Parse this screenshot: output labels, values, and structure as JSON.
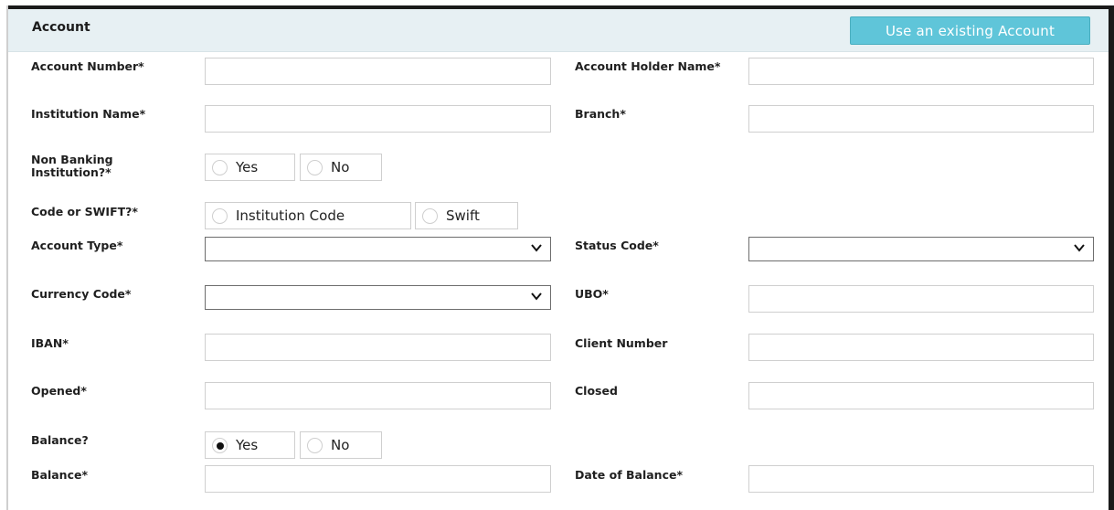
{
  "section": {
    "title": "Account",
    "use_existing_button": "Use an existing Account"
  },
  "labels": {
    "account_number": "Account Number*",
    "account_holder_name": "Account Holder Name*",
    "institution_name": "Institution Name*",
    "branch": "Branch*",
    "non_banking": "Non Banking Institution?*",
    "code_or_swift": "Code or SWIFT?*",
    "account_type": "Account Type*",
    "status_code": "Status Code*",
    "currency_code": "Currency Code*",
    "ubo": "UBO*",
    "iban": "IBAN*",
    "client_number": "Client Number",
    "opened": "Opened*",
    "closed": "Closed",
    "balance_q": "Balance?",
    "balance": "Balance*",
    "date_of_balance": "Date of Balance*"
  },
  "radios": {
    "non_banking": [
      {
        "label": "Yes",
        "checked": false
      },
      {
        "label": "No",
        "checked": false
      }
    ],
    "code_or_swift": [
      {
        "label": "Institution Code",
        "checked": false
      },
      {
        "label": "Swift",
        "checked": false
      }
    ],
    "balance_q": [
      {
        "label": "Yes",
        "checked": true
      },
      {
        "label": "No",
        "checked": false
      }
    ]
  },
  "values": {
    "account_number": "",
    "account_holder_name": "",
    "institution_name": "",
    "branch": "",
    "account_type": "",
    "status_code": "",
    "currency_code": "",
    "ubo": "",
    "iban": "",
    "client_number": "",
    "opened": "",
    "closed": "",
    "balance": "",
    "date_of_balance": ""
  },
  "icons": {
    "dropdown": "chevron-down-icon",
    "radio": "radio-button-icon"
  },
  "colors": {
    "header_bg": "#e7f0f3",
    "button_bg": "#5fc5d9"
  }
}
